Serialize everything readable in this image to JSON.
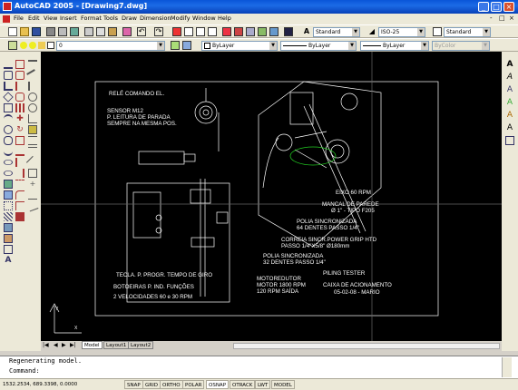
{
  "titlebar": {
    "title": "AutoCAD 2005 - [Drawing7.dwg]",
    "min": "_",
    "max": "□",
    "close": "×"
  },
  "menubar": {
    "items": [
      "File",
      "Edit",
      "View",
      "Insert",
      "Format",
      "Tools",
      "Draw",
      "Dimension",
      "Modify",
      "Window",
      "Help"
    ],
    "mdi": [
      "-",
      "□",
      "×"
    ]
  },
  "toolbar1": {
    "textstyle": "Standard",
    "dimstyle": "ISO-25",
    "tablestyle": "Standard"
  },
  "toolbar2": {
    "layer": "0",
    "color": "ByLayer",
    "linetype": "ByLayer",
    "lineweight": "ByLayer",
    "plotstyle": "ByColor"
  },
  "tabs": {
    "model": "Model",
    "layout1": "Layout1",
    "layout2": "Layout2"
  },
  "drawing": {
    "rele": "RELÉ COMANDO EL.",
    "sensor1": "SENSOR M12",
    "sensor2": "P. LEITURA DE PARADA",
    "sensor3": "SEMPRE NA MESMA POS.",
    "eixo": "EIXO 60 RPM",
    "mancal1": "MANCAL DE PAREDE",
    "mancal2": "Ø 1\" - TIPO F205",
    "polia1a": "POLIA SINCRONIZADA",
    "polia1b": "64 DENTES PASSO 1/4\"",
    "correia1": "CORREIA SINCR.POWER GRIP HTD",
    "correia2": "PASSO 1/4\"X5/8\" Ø180mm",
    "polia2a": "POLIA SINCRONIZADA",
    "polia2b": "32 DENTES PASSO 1/4\"",
    "tecla": "TECLA. P. PROGR. TEMPO DE GIRO",
    "botoeiras": "BOTOEIRAS P. IND. FUNÇÕES",
    "velocidades": "2 VELOCIDADES 60 e 30 RPM",
    "motor1": "MOTOREDUTOR",
    "motor2": "MOTOR 1800 RPM",
    "motor3": "120 RPM SAÍDA",
    "piling1": "PILING TESTER",
    "piling2": "CAIXA DE ACIONAMENTO",
    "piling3": "05-02-08 - MARIO",
    "ucs_x": "X",
    "ucs_y": "Y"
  },
  "command": {
    "line1": "Regenerating model.",
    "line2": "Command:"
  },
  "status": {
    "coords": "1532.2534, 689.3398, 0.0000",
    "buttons": [
      "SNAP",
      "GRID",
      "ORTHO",
      "POLAR",
      "OSNAP",
      "OTRACK",
      "LWT",
      "MODEL"
    ]
  },
  "colors": {
    "accent": "#0a55d8",
    "canvas": "#000000",
    "chrome": "#ece9d8"
  }
}
